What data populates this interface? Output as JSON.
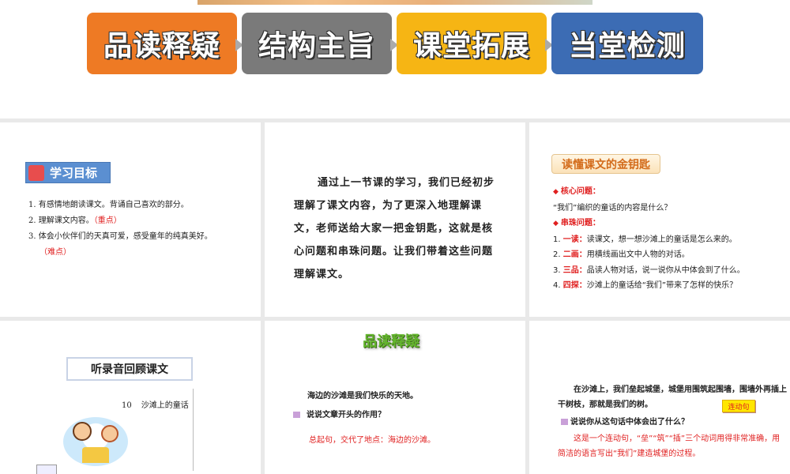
{
  "banner": {
    "steps": [
      {
        "label": "品读释疑",
        "color": "#ee7a24"
      },
      {
        "label": "结构主旨",
        "color": "#7a7a7a"
      },
      {
        "label": "课堂拓展",
        "color": "#f6b514"
      },
      {
        "label": "当堂检测",
        "color": "#3c6cb4"
      }
    ]
  },
  "panel1": {
    "tag": "学习目标",
    "items": [
      {
        "text": "1. 有感情地朗读课文。背诵自己喜欢的部分。",
        "note": ""
      },
      {
        "text": "2. 理解课文内容。",
        "note": "（重点）"
      },
      {
        "text": "3. 体会小伙伴们的天真可爱，感受童年的纯真美好。",
        "note": "（难点）"
      }
    ]
  },
  "panel2": {
    "paragraph": "通过上一节课的学习，我们已经初步理解了课文内容，为了更深入地理解课文，老师送给大家一把金钥匙，这就是核心问题和串珠问题。让我们带着这些问题理解课文。"
  },
  "panel3": {
    "tag": "读懂课文的金钥匙",
    "core_label": "核心问题：",
    "core_question": "“我们”编织的童话的内容是什么？",
    "chain_label": "串珠问题：",
    "chain": [
      {
        "num": "1.",
        "key": "一读：",
        "text": "读课文，想一想沙滩上的童话是怎么来的。"
      },
      {
        "num": "2.",
        "key": "二画：",
        "text": "用横线画出文中人物的对话。"
      },
      {
        "num": "3.",
        "key": "三品：",
        "text": "品读人物对话，说一说你从中体会到了什么。"
      },
      {
        "num": "4.",
        "key": "四探：",
        "text": "沙滩上的童话给“我们”带来了怎样的快乐？"
      }
    ]
  },
  "panel4": {
    "title": "听录音回顾课文",
    "lesson_num": "10",
    "lesson_title": "沙滩上的童话"
  },
  "panel5": {
    "title": "品读释疑",
    "quote": "海边的沙滩是我们快乐的天地。",
    "question": "说说文章开头的作用？",
    "answer": "总起句，交代了地点：海边的沙滩。"
  },
  "panel6": {
    "quote": "在沙滩上，我们垒起城堡，城堡用围筑起围墙，围墙外再插上干树枝，那就是我们的树。",
    "tag": "连动句",
    "question": "说说你从这句话中体会出了什么？",
    "answer": "这是一个连动句，“垒”“筑”“插”三个动词用得非常准确，用简洁的语言写出“我们”建造城堡的过程。"
  }
}
